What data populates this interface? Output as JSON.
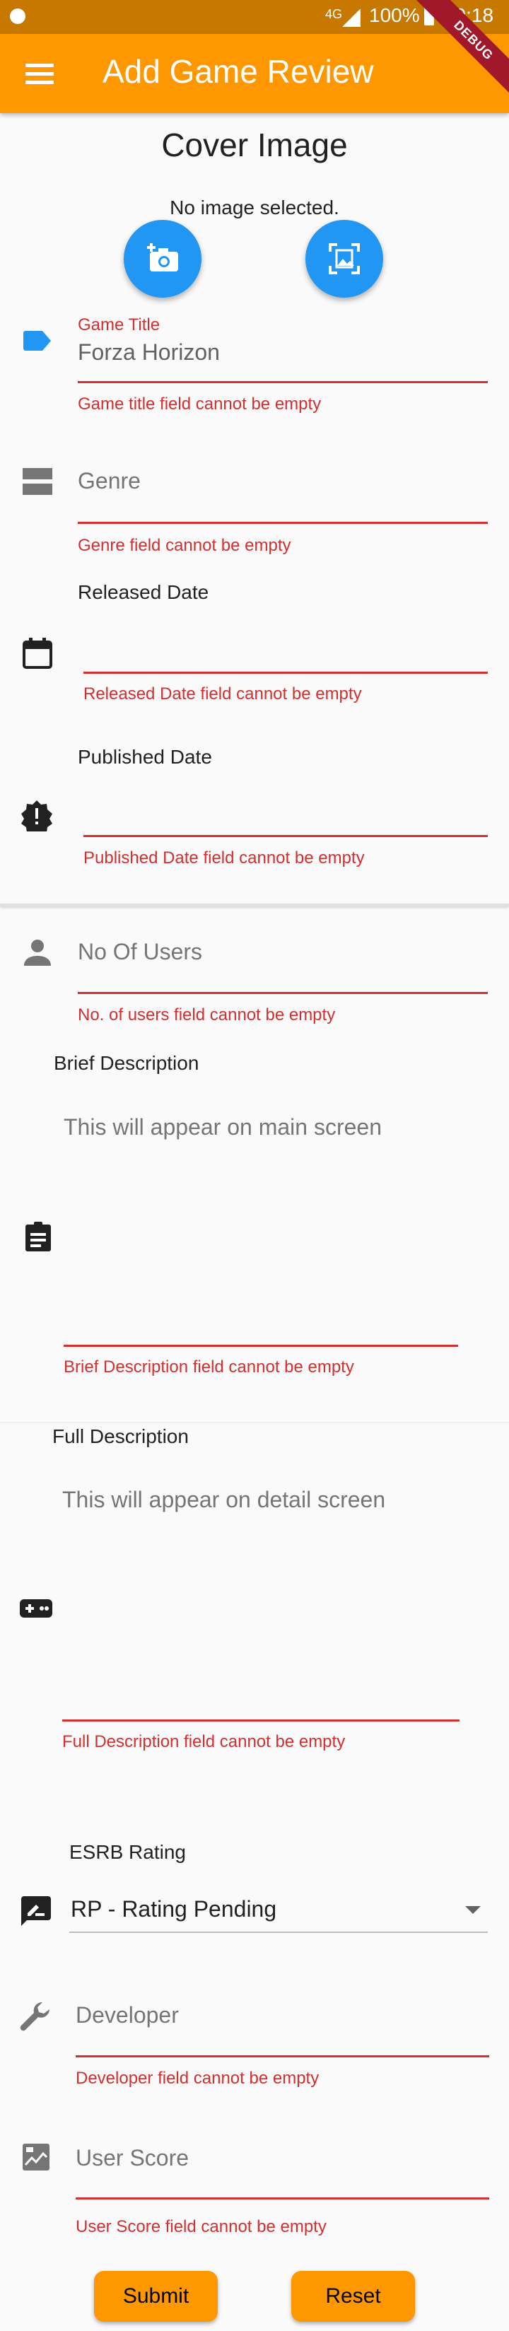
{
  "status_bar": {
    "signal": "4G",
    "battery": "100%",
    "time": "19:18"
  },
  "app_bar": {
    "title": "Add Game Review",
    "debug_badge": "DEBUG"
  },
  "cover": {
    "title": "Cover Image",
    "status": "No image selected."
  },
  "game_title": {
    "label": "Game Title",
    "value": "Forza Horizon",
    "error": "Game title field cannot be empty"
  },
  "genre": {
    "placeholder": "Genre",
    "error": "Genre field cannot be empty"
  },
  "released_date": {
    "label": "Released Date",
    "error": "Released Date field cannot be empty"
  },
  "published_date": {
    "label": "Published Date",
    "error": "Published Date field cannot be empty"
  },
  "no_of_users": {
    "placeholder": "No Of Users",
    "error": "No. of users field cannot be empty"
  },
  "brief_description": {
    "label": "Brief Description",
    "placeholder": "This will appear on main screen",
    "error": "Brief Description field cannot be empty"
  },
  "full_description": {
    "label": "Full Description",
    "placeholder": "This will appear on detail screen",
    "error": "Full Description field cannot be empty"
  },
  "esrb": {
    "label": "ESRB Rating",
    "selected": "RP - Rating Pending"
  },
  "developer": {
    "placeholder": "Developer",
    "error": "Developer field cannot be empty"
  },
  "user_score": {
    "placeholder": "User Score",
    "error": "User Score field cannot be empty"
  },
  "actions": {
    "submit": "Submit",
    "reset": "Reset"
  },
  "colors": {
    "primary": "#ff9800",
    "accent": "#2196f3",
    "error": "#d32f2f"
  }
}
